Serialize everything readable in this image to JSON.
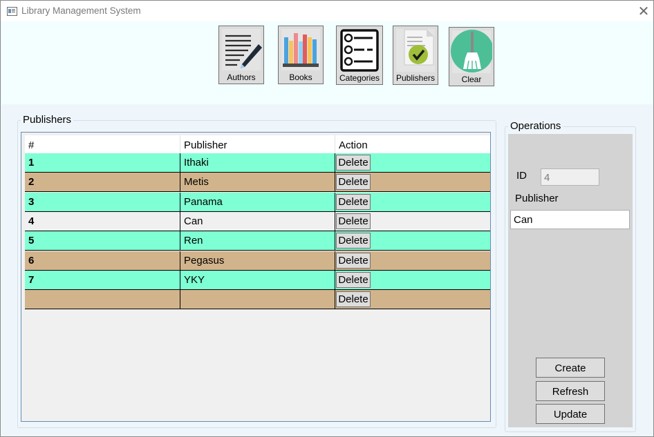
{
  "window": {
    "title": "Library Management System",
    "close_glyph": "✕"
  },
  "toolbar": {
    "buttons": [
      {
        "label": "Authors",
        "icon": "pen-writing-icon"
      },
      {
        "label": "Books",
        "icon": "bookshelf-icon"
      },
      {
        "label": "Categories",
        "icon": "checklist-icon"
      },
      {
        "label": "Publishers",
        "icon": "document-check-icon"
      },
      {
        "label": "Clear",
        "icon": "broom-icon"
      }
    ]
  },
  "publishers": {
    "group_title": "Publishers",
    "columns": [
      "#",
      "Publisher",
      "Action"
    ],
    "delete_label": "Delete",
    "rows": [
      {
        "id": "1",
        "name": "Ithaki"
      },
      {
        "id": "2",
        "name": "Metis"
      },
      {
        "id": "3",
        "name": "Panama"
      },
      {
        "id": "4",
        "name": "Can"
      },
      {
        "id": "5",
        "name": "Ren"
      },
      {
        "id": "6",
        "name": "Pegasus"
      },
      {
        "id": "7",
        "name": "YKY"
      },
      {
        "id": "",
        "name": ""
      }
    ],
    "row_colors": [
      "#7fffd4",
      "#d2b48c",
      "#7fffd4",
      "#f0f0f0",
      "#7fffd4",
      "#d2b48c",
      "#7fffd4",
      "#d2b48c"
    ]
  },
  "operations": {
    "group_title": "Operations",
    "id_label": "ID",
    "id_value": "4",
    "publisher_label": "Publisher",
    "publisher_value": "Can",
    "create_label": "Create",
    "refresh_label": "Refresh",
    "update_label": "Update"
  }
}
